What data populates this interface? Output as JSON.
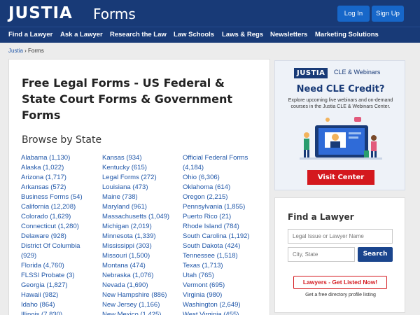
{
  "header": {
    "logo": "JUSTIA",
    "section": "Forms",
    "login": "Log In",
    "signup": "Sign Up"
  },
  "nav": [
    "Find a Lawyer",
    "Ask a Lawyer",
    "Research the Law",
    "Law Schools",
    "Laws & Regs",
    "Newsletters",
    "Marketing Solutions"
  ],
  "breadcrumb": {
    "home": "Justia",
    "sep": "›",
    "current": "Forms"
  },
  "main": {
    "title": "Free Legal Forms - US Federal & State Court Forms & Government Forms",
    "browse": "Browse by State",
    "col1": [
      "Alabama (1,130)",
      "Alaska (1,022)",
      "Arizona (1,717)",
      "Arkansas (572)",
      "Business Forms (54)",
      "California (12,208)",
      "Colorado (1,629)",
      "Connecticut (1,280)",
      "Delaware (928)",
      "District Of Columbia",
      "(929)",
      "Florida (4,760)",
      "FLSSI Probate (3)",
      "Georgia (1,827)",
      "Hawaii (982)",
      "Idaho (864)",
      "Illinois (7,830)"
    ],
    "col2": [
      "Kansas (934)",
      "Kentucky (615)",
      "Legal Forms (272)",
      "Louisiana (473)",
      "Maine (738)",
      "Maryland (961)",
      "Massachusetts (1,049)",
      "Michigan (2,019)",
      "Minnesota (1,339)",
      "Mississippi (303)",
      "Missouri (1,500)",
      "Montana (474)",
      "Nebraska (1,076)",
      "Nevada (1,690)",
      "New Hampshire (886)",
      "New Jersey (1,166)",
      "New Mexico (1,425)"
    ],
    "col3": [
      "Official Federal Forms",
      "(4,184)",
      "Ohio (6,306)",
      "Oklahoma (614)",
      "Oregon (2,215)",
      "Pennsylvania (1,855)",
      "Puerto Rico (21)",
      "Rhode Island (784)",
      "South Carolina (1,192)",
      "South Dakota (424)",
      "Tennessee (1,518)",
      "Texas (1,713)",
      "Utah (765)",
      "Vermont (695)",
      "Virginia (980)",
      "Washington (2,649)",
      "West Virginia (455)"
    ]
  },
  "cle": {
    "brand": "JUSTIA",
    "brand_sub": "CLE & Webinars",
    "heading": "Need CLE Credit?",
    "desc": "Explore upcoming live webinars and on-demand courses in the Justia CLE & Webinars Center.",
    "button": "Visit Center"
  },
  "find_lawyer": {
    "title": "Find a Lawyer",
    "issue_placeholder": "Legal Issue or Lawyer Name",
    "location_placeholder": "City, State",
    "search": "Search",
    "listed": "Lawyers - Get Listed Now!",
    "note": "Get a free directory profile listing"
  },
  "colors": {
    "brand": "#183a77",
    "link": "#1f56a8",
    "accent_red": "#d4181e",
    "button_blue": "#1767c9"
  }
}
